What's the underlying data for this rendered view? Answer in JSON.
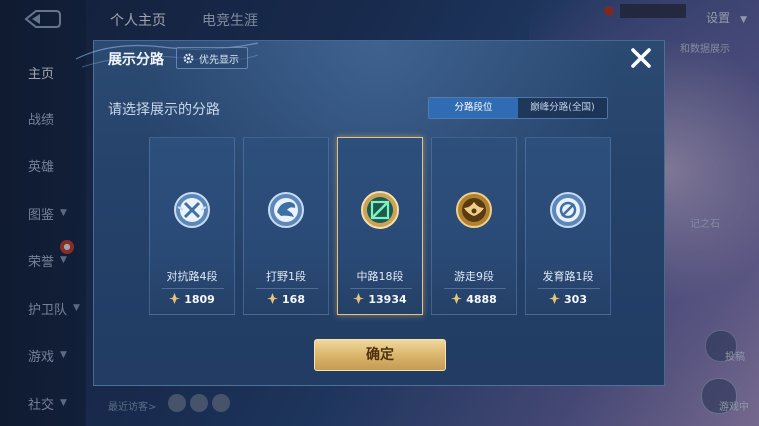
{
  "sidebar": {
    "items": [
      {
        "label": "主页",
        "active": true
      },
      {
        "label": "战绩"
      },
      {
        "label": "英雄"
      },
      {
        "label": "图鉴",
        "expandable": true
      },
      {
        "label": "荣誉",
        "expandable": true
      },
      {
        "label": "护卫队",
        "expandable": true
      },
      {
        "label": "游戏",
        "expandable": true
      },
      {
        "label": "社交",
        "expandable": true
      }
    ]
  },
  "topbar": {
    "tabs": [
      "个人主页",
      "电竞生涯"
    ],
    "settings_label": "设置"
  },
  "background": {
    "side_text": "和数据展示",
    "side_text2": "记之石",
    "recent_visitors": "最近访客>",
    "corner_label": "游戏中",
    "corner_label2": "投稿"
  },
  "dialog": {
    "title": "展示分路",
    "priority_button": "优先显示",
    "prompt": "请选择展示的分路",
    "tabs": [
      {
        "label": "分路段位",
        "active": true
      },
      {
        "label": "巅峰分路(全国)",
        "active": false
      }
    ],
    "cards": [
      {
        "role": "对抗路4段",
        "score": "1809",
        "icon": "clash-lane-emblem-icon",
        "selected": false
      },
      {
        "role": "打野1段",
        "score": "168",
        "icon": "jungle-emblem-icon",
        "selected": false
      },
      {
        "role": "中路18段",
        "score": "13934",
        "icon": "mid-lane-emblem-icon",
        "selected": true
      },
      {
        "role": "游走9段",
        "score": "4888",
        "icon": "roam-emblem-icon",
        "selected": false
      },
      {
        "role": "发育路1段",
        "score": "303",
        "icon": "farm-lane-emblem-icon",
        "selected": false
      }
    ],
    "confirm_label": "确定"
  },
  "colors": {
    "accent_gold": "#e7c27a",
    "active_tab": "#2f6cb4",
    "dialog_bg": "#25426a"
  }
}
